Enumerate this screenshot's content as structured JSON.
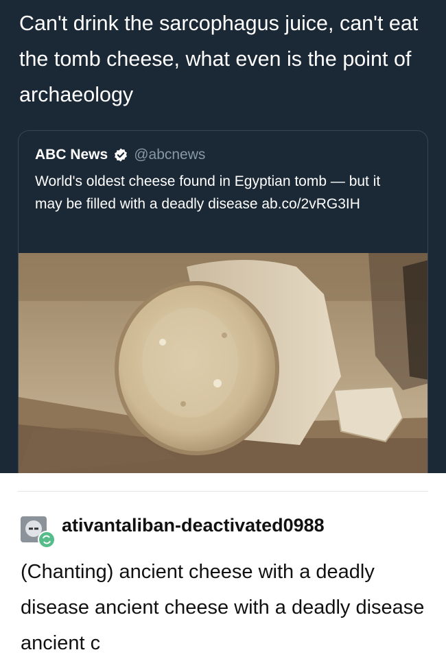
{
  "tweet": {
    "text": "Can't drink the sarcophagus juice, can't eat the tomb cheese, what even is the point of archaeology"
  },
  "quoted_tweet": {
    "author_name": "ABC News",
    "verified": true,
    "handle": "@abcnews",
    "text": "World's oldest cheese found in Egyptian tomb — but it may be filled with a deadly disease ab.co/2vRG3IH",
    "image": "photo-of-ancient-cheese-jar"
  },
  "reblog": {
    "username": "ativantaliban-deactivated0988",
    "text": "(Chanting) ancient cheese with a deadly disease ancient cheese with a deadly disease ancient c"
  },
  "colors": {
    "dark_bg": "#1b2836",
    "verified_badge": "#ffffff",
    "handle": "#8899a6",
    "reblog_badge": "#56bc8a"
  }
}
